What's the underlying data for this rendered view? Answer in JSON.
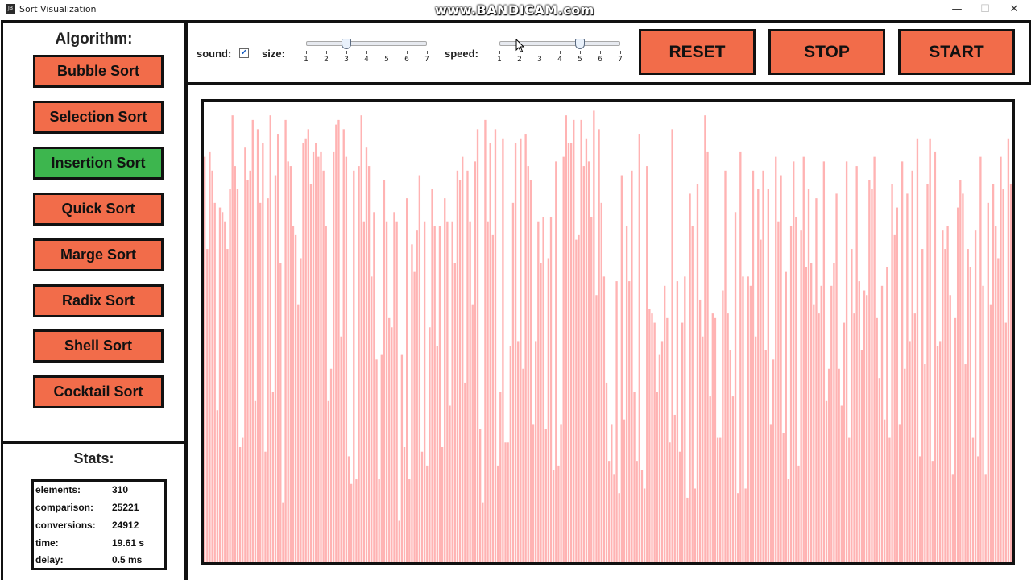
{
  "window": {
    "title": "Sort Visualization",
    "icon_text": "JB",
    "watermark": "www.BANDICAM.com",
    "minimize": "—",
    "maximize": "☐",
    "close": "✕"
  },
  "sidebar": {
    "heading": "Algorithm:",
    "items": [
      {
        "label": "Bubble Sort",
        "active": false
      },
      {
        "label": "Selection Sort",
        "active": false
      },
      {
        "label": "Insertion Sort",
        "active": true
      },
      {
        "label": "Quick Sort",
        "active": false
      },
      {
        "label": "Marge Sort",
        "active": false
      },
      {
        "label": "Radix Sort",
        "active": false
      },
      {
        "label": "Shell Sort",
        "active": false
      },
      {
        "label": "Cocktail Sort",
        "active": false
      }
    ],
    "colors": {
      "button": "#f26c4a",
      "active": "#3db64e"
    }
  },
  "stats": {
    "heading": "Stats:",
    "rows": [
      {
        "key": "elements:",
        "value": "310"
      },
      {
        "key": "comparison:",
        "value": "25221"
      },
      {
        "key": "conversions:",
        "value": "24912"
      },
      {
        "key": "time:",
        "value": "19.61 s"
      },
      {
        "key": "delay:",
        "value": "0.5 ms"
      }
    ]
  },
  "controls": {
    "sound_label": "sound:",
    "sound_checked": true,
    "size_label": "size:",
    "size_value": 3,
    "speed_label": "speed:",
    "speed_value": 5,
    "ticks": [
      "1",
      "2",
      "3",
      "4",
      "5",
      "6",
      "7"
    ],
    "reset_label": "RESET",
    "stop_label": "STOP",
    "start_label": "START"
  },
  "chart_data": {
    "type": "bar",
    "bar_color": "#ffb3b3",
    "values": [
      88,
      68,
      89,
      85,
      78,
      33,
      77,
      76,
      74,
      68,
      81,
      97,
      86,
      81,
      25,
      27,
      90,
      83,
      85,
      96,
      35,
      94,
      78,
      91,
      24,
      79,
      97,
      37,
      84,
      93,
      65,
      13,
      96,
      87,
      86,
      73,
      71,
      56,
      66,
      91,
      92,
      94,
      82,
      89,
      91,
      88,
      89,
      85,
      73,
      35,
      42,
      89,
      95,
      96,
      49,
      94,
      88,
      23,
      17,
      85,
      18,
      86,
      97,
      74,
      90,
      86,
      62,
      76,
      44,
      18,
      45,
      83,
      74,
      53,
      51,
      76,
      74,
      9,
      45,
      25,
      79,
      18,
      69,
      63,
      72,
      84,
      24,
      74,
      21,
      51,
      81,
      73,
      47,
      73,
      25,
      79,
      74,
      34,
      74,
      65,
      85,
      83,
      88,
      39,
      85,
      74,
      56,
      87,
      94,
      29,
      13,
      96,
      74,
      91,
      71,
      94,
      21,
      37,
      92,
      26,
      26,
      47,
      78,
      91,
      48,
      92,
      42,
      93,
      86,
      83,
      30,
      48,
      74,
      65,
      75,
      29,
      66,
      75,
      20,
      87,
      21,
      30,
      88,
      97,
      91,
      91,
      96,
      70,
      71,
      96,
      86,
      92,
      87,
      75,
      98,
      58,
      94,
      78,
      62,
      39,
      22,
      30,
      19,
      61,
      15,
      84,
      31,
      73,
      61,
      85,
      37,
      22,
      93,
      20,
      16,
      86,
      55,
      54,
      52,
      37,
      45,
      48,
      60,
      53,
      26,
      94,
      32,
      61,
      24,
      52,
      62,
      14,
      80,
      73,
      16,
      82,
      57,
      49,
      97,
      89,
      36,
      54,
      53,
      27,
      27,
      59,
      85,
      54,
      46,
      36,
      76,
      15,
      89,
      62,
      16,
      62,
      60,
      85,
      49,
      81,
      70,
      85,
      46,
      81,
      30,
      44,
      88,
      74,
      84,
      28,
      63,
      18,
      73,
      87,
      75,
      21,
      72,
      88,
      64,
      81,
      65,
      56,
      79,
      54,
      60,
      87,
      35,
      42,
      60,
      65,
      80,
      42,
      34,
      52,
      87,
      27,
      68,
      54,
      86,
      61,
      46,
      59,
      58,
      83,
      81,
      88,
      53,
      40,
      60,
      31,
      64,
      27,
      82,
      71,
      77,
      30,
      87,
      42,
      80,
      48,
      85,
      54,
      92,
      23,
      68,
      43,
      82,
      92,
      22,
      89,
      47,
      48,
      72,
      68,
      73,
      58,
      19,
      53,
      77,
      83,
      80,
      43,
      68,
      64,
      27,
      72,
      23,
      88,
      60,
      19,
      78,
      56,
      82,
      73,
      66,
      88,
      81,
      52,
      92,
      82
    ]
  }
}
